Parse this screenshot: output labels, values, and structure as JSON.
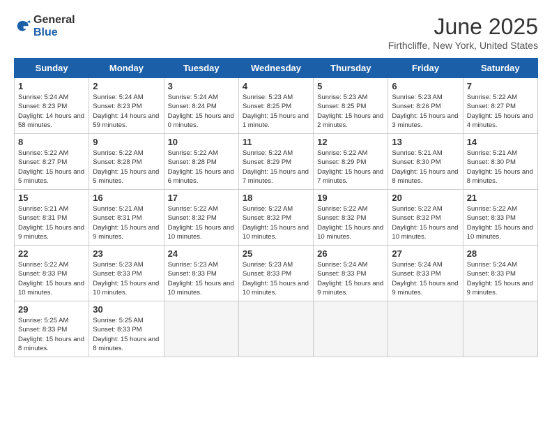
{
  "header": {
    "logo_general": "General",
    "logo_blue": "Blue",
    "month_title": "June 2025",
    "location": "Firthcliffe, New York, United States"
  },
  "weekdays": [
    "Sunday",
    "Monday",
    "Tuesday",
    "Wednesday",
    "Thursday",
    "Friday",
    "Saturday"
  ],
  "weeks": [
    [
      {
        "day": 1,
        "sunrise": "5:24 AM",
        "sunset": "8:23 PM",
        "daylight": "14 hours and 58 minutes."
      },
      {
        "day": 2,
        "sunrise": "5:24 AM",
        "sunset": "8:23 PM",
        "daylight": "14 hours and 59 minutes."
      },
      {
        "day": 3,
        "sunrise": "5:24 AM",
        "sunset": "8:24 PM",
        "daylight": "15 hours and 0 minutes."
      },
      {
        "day": 4,
        "sunrise": "5:23 AM",
        "sunset": "8:25 PM",
        "daylight": "15 hours and 1 minute."
      },
      {
        "day": 5,
        "sunrise": "5:23 AM",
        "sunset": "8:25 PM",
        "daylight": "15 hours and 2 minutes."
      },
      {
        "day": 6,
        "sunrise": "5:23 AM",
        "sunset": "8:26 PM",
        "daylight": "15 hours and 3 minutes."
      },
      {
        "day": 7,
        "sunrise": "5:22 AM",
        "sunset": "8:27 PM",
        "daylight": "15 hours and 4 minutes."
      }
    ],
    [
      {
        "day": 8,
        "sunrise": "5:22 AM",
        "sunset": "8:27 PM",
        "daylight": "15 hours and 5 minutes."
      },
      {
        "day": 9,
        "sunrise": "5:22 AM",
        "sunset": "8:28 PM",
        "daylight": "15 hours and 5 minutes."
      },
      {
        "day": 10,
        "sunrise": "5:22 AM",
        "sunset": "8:28 PM",
        "daylight": "15 hours and 6 minutes."
      },
      {
        "day": 11,
        "sunrise": "5:22 AM",
        "sunset": "8:29 PM",
        "daylight": "15 hours and 7 minutes."
      },
      {
        "day": 12,
        "sunrise": "5:22 AM",
        "sunset": "8:29 PM",
        "daylight": "15 hours and 7 minutes."
      },
      {
        "day": 13,
        "sunrise": "5:21 AM",
        "sunset": "8:30 PM",
        "daylight": "15 hours and 8 minutes."
      },
      {
        "day": 14,
        "sunrise": "5:21 AM",
        "sunset": "8:30 PM",
        "daylight": "15 hours and 8 minutes."
      }
    ],
    [
      {
        "day": 15,
        "sunrise": "5:21 AM",
        "sunset": "8:31 PM",
        "daylight": "15 hours and 9 minutes."
      },
      {
        "day": 16,
        "sunrise": "5:21 AM",
        "sunset": "8:31 PM",
        "daylight": "15 hours and 9 minutes."
      },
      {
        "day": 17,
        "sunrise": "5:22 AM",
        "sunset": "8:32 PM",
        "daylight": "15 hours and 10 minutes."
      },
      {
        "day": 18,
        "sunrise": "5:22 AM",
        "sunset": "8:32 PM",
        "daylight": "15 hours and 10 minutes."
      },
      {
        "day": 19,
        "sunrise": "5:22 AM",
        "sunset": "8:32 PM",
        "daylight": "15 hours and 10 minutes."
      },
      {
        "day": 20,
        "sunrise": "5:22 AM",
        "sunset": "8:32 PM",
        "daylight": "15 hours and 10 minutes."
      },
      {
        "day": 21,
        "sunrise": "5:22 AM",
        "sunset": "8:33 PM",
        "daylight": "15 hours and 10 minutes."
      }
    ],
    [
      {
        "day": 22,
        "sunrise": "5:22 AM",
        "sunset": "8:33 PM",
        "daylight": "15 hours and 10 minutes."
      },
      {
        "day": 23,
        "sunrise": "5:23 AM",
        "sunset": "8:33 PM",
        "daylight": "15 hours and 10 minutes."
      },
      {
        "day": 24,
        "sunrise": "5:23 AM",
        "sunset": "8:33 PM",
        "daylight": "15 hours and 10 minutes."
      },
      {
        "day": 25,
        "sunrise": "5:23 AM",
        "sunset": "8:33 PM",
        "daylight": "15 hours and 10 minutes."
      },
      {
        "day": 26,
        "sunrise": "5:24 AM",
        "sunset": "8:33 PM",
        "daylight": "15 hours and 9 minutes."
      },
      {
        "day": 27,
        "sunrise": "5:24 AM",
        "sunset": "8:33 PM",
        "daylight": "15 hours and 9 minutes."
      },
      {
        "day": 28,
        "sunrise": "5:24 AM",
        "sunset": "8:33 PM",
        "daylight": "15 hours and 9 minutes."
      }
    ],
    [
      {
        "day": 29,
        "sunrise": "5:25 AM",
        "sunset": "8:33 PM",
        "daylight": "15 hours and 8 minutes."
      },
      {
        "day": 30,
        "sunrise": "5:25 AM",
        "sunset": "8:33 PM",
        "daylight": "15 hours and 8 minutes."
      },
      null,
      null,
      null,
      null,
      null
    ]
  ]
}
